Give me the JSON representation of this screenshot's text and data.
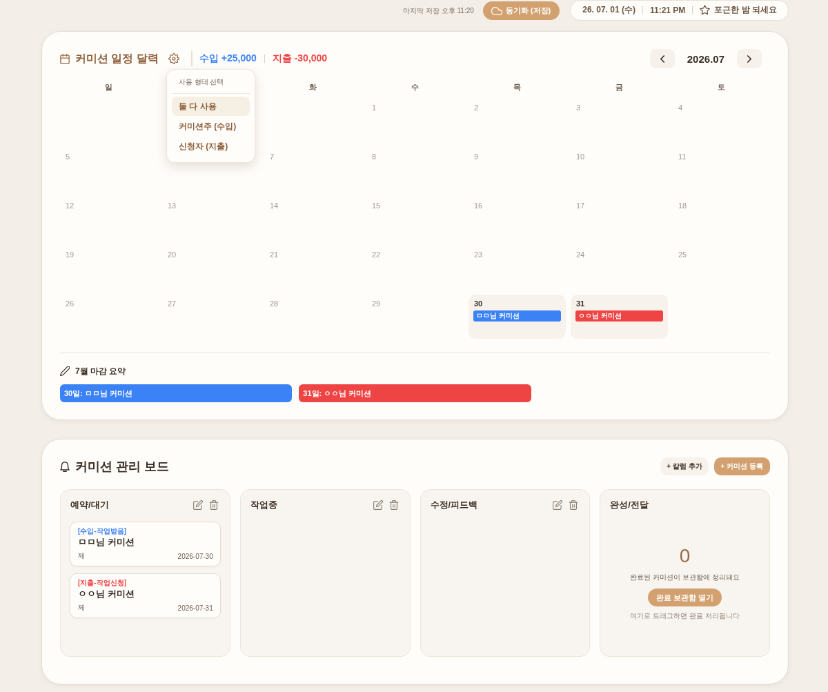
{
  "top_bar": {
    "last_saved": "마지막 저장 오후 11:20",
    "sync_button": "동기화 (저장)",
    "date": "26. 07. 01 (수)",
    "time": "11:21 PM",
    "greeting": "포근한 밤 되세요"
  },
  "calendar": {
    "title": "커미션 일정 달력",
    "income": "수입 +25,000",
    "expense": "지출 -30,000",
    "month": "2026.07",
    "usage_menu": {
      "open": true,
      "title": "사용 형태 선택",
      "options": [
        {
          "label": "둘 다 사용",
          "selected": true
        },
        {
          "label": "커미션주 (수입)",
          "selected": false
        },
        {
          "label": "신청자 (지출)",
          "selected": false
        }
      ]
    },
    "weekdays": [
      {
        "kind": "label",
        "label": "일"
      },
      {
        "kind": "blank"
      },
      {
        "kind": "label",
        "label": "화"
      },
      {
        "kind": "label",
        "label": "수"
      },
      {
        "kind": "label",
        "label": "목"
      },
      {
        "kind": "label",
        "label": "금"
      },
      {
        "kind": "label",
        "label": "토"
      }
    ],
    "weeks": [
      [
        {
          "kind": "blank"
        },
        {
          "kind": "blank"
        },
        {
          "kind": "blank"
        },
        {
          "kind": "day",
          "day": "1"
        },
        {
          "kind": "day",
          "day": "2"
        },
        {
          "kind": "day",
          "day": "3"
        },
        {
          "kind": "day",
          "day": "4"
        }
      ],
      [
        {
          "kind": "day",
          "day": "5"
        },
        {
          "kind": "blank"
        },
        {
          "kind": "day",
          "day": "7"
        },
        {
          "kind": "day",
          "day": "8"
        },
        {
          "kind": "day",
          "day": "9"
        },
        {
          "kind": "day",
          "day": "10"
        },
        {
          "kind": "day",
          "day": "11"
        }
      ],
      [
        {
          "kind": "day",
          "day": "12"
        },
        {
          "kind": "day",
          "day": "13"
        },
        {
          "kind": "day",
          "day": "14"
        },
        {
          "kind": "day",
          "day": "15"
        },
        {
          "kind": "day",
          "day": "16"
        },
        {
          "kind": "day",
          "day": "17"
        },
        {
          "kind": "day",
          "day": "18"
        }
      ],
      [
        {
          "kind": "day",
          "day": "19"
        },
        {
          "kind": "day",
          "day": "20"
        },
        {
          "kind": "day",
          "day": "21"
        },
        {
          "kind": "day",
          "day": "22"
        },
        {
          "kind": "day",
          "day": "23"
        },
        {
          "kind": "day",
          "day": "24"
        },
        {
          "kind": "day",
          "day": "25"
        }
      ],
      [
        {
          "kind": "day",
          "day": "26"
        },
        {
          "kind": "day",
          "day": "27"
        },
        {
          "kind": "day",
          "day": "28"
        },
        {
          "kind": "day",
          "day": "29"
        },
        {
          "kind": "day",
          "day": "30",
          "events": [
            {
              "label": "ㅁㅁ님 커미션",
              "color": "#3b82f6"
            }
          ]
        },
        {
          "kind": "day",
          "day": "31",
          "events": [
            {
              "label": "ㅇㅇ님 커미션",
              "color": "#ef4444"
            }
          ]
        },
        {
          "kind": "blank"
        }
      ]
    ],
    "summary": {
      "title": "7월 마감 요약",
      "items": [
        {
          "label": "30일: ㅁㅁ님 커미션",
          "color": "#3b82f6"
        },
        {
          "label": "31일: ㅇㅇ님 커미션",
          "color": "#ef4444"
        }
      ]
    }
  },
  "board": {
    "title": "커미션 관리 보드",
    "add_column_button": "+ 칼럼 추가",
    "add_commission_button": "+ 커미션 등록",
    "columns": [
      {
        "kind": "list",
        "title": "예약/대기",
        "cards": [
          {
            "tag": "[수입-작업받음]",
            "color": "#3b82f6",
            "title": "ㅁㅁ님 커미션",
            "footer": "제",
            "date": "2026-07-30"
          },
          {
            "tag": "[지출-작업신청]",
            "color": "#ef4444",
            "title": "ㅇㅇ님 커미션",
            "footer": "제",
            "date": "2026-07-31"
          }
        ]
      },
      {
        "kind": "list",
        "title": "작업중"
      },
      {
        "kind": "list",
        "title": "수정/피드백"
      },
      {
        "kind": "archive",
        "title": "완성/전달",
        "count": "0",
        "message": "완료된 커미션이 보관함에 정리돼요",
        "button": "완료 보관함 열기",
        "hint": "여기로 드래그하면 완료 처리됩니다"
      }
    ]
  }
}
